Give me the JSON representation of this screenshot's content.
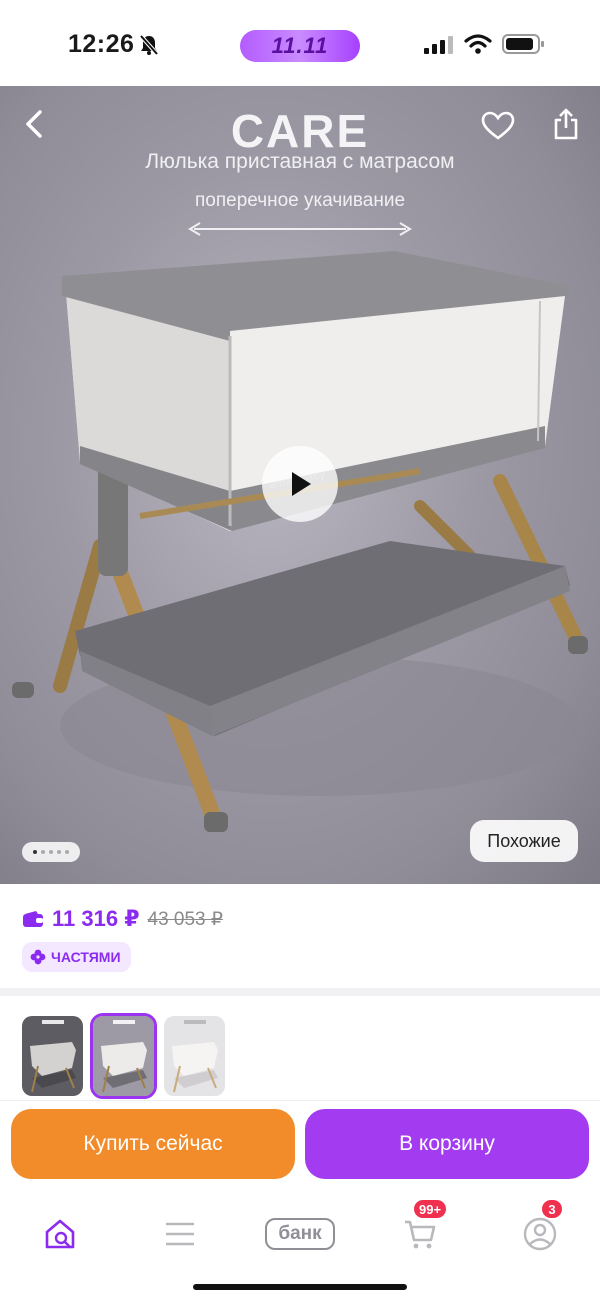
{
  "status_bar": {
    "time": "12:26",
    "promo_label": "11.11"
  },
  "hero": {
    "brand": "CARE",
    "subtitle": "Люлька приставная с матрасом",
    "subtitle2": "поперечное укачивание",
    "similar_label": "Похожие",
    "dots_count": 5,
    "active_dot": 0
  },
  "price": {
    "current": "11 316 ₽",
    "old": "43 053 ₽",
    "installments_label": "ЧАСТЯМИ"
  },
  "actions": {
    "buy_now": "Купить сейчас",
    "add_to_cart": "В корзину"
  },
  "nav": {
    "bank_label": "банк",
    "cart_badge": "99+",
    "profile_badge": "3"
  },
  "colors": {
    "accent": "#8b2bf0",
    "buy": "#f28c2a",
    "cart": "#a33cf0",
    "badge": "#f0304f"
  }
}
